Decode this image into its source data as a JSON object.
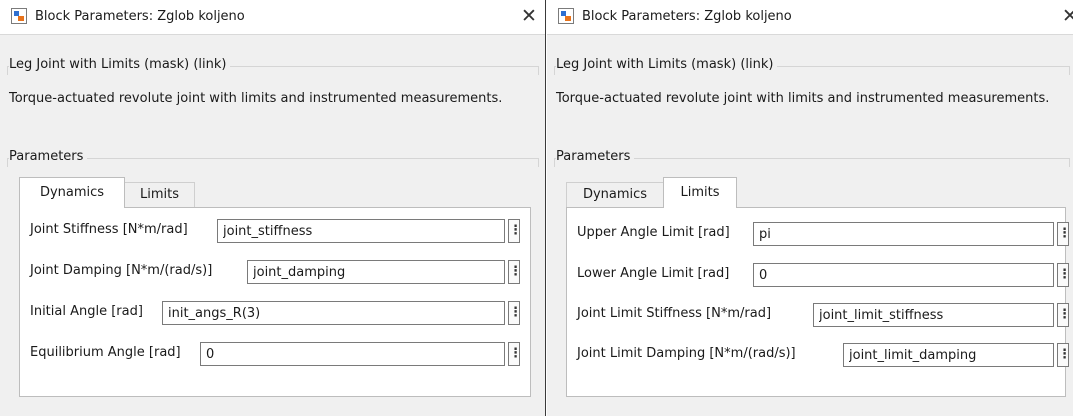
{
  "dialogs": [
    {
      "title": "Block Parameters: Zglob koljeno",
      "close_glyph": "✕",
      "group_title": "Leg Joint with Limits (mask) (link)",
      "description": "Torque-actuated revolute joint with limits and instrumented measurements.",
      "parameters_title": "Parameters",
      "tabs": [
        {
          "label": "Dynamics",
          "active": true
        },
        {
          "label": "Limits",
          "active": false
        }
      ],
      "params": [
        {
          "label": "Joint Stiffness [N*m/rad]",
          "value": "joint_stiffness",
          "menu": "⋮"
        },
        {
          "label": "Joint Damping [N*m/(rad/s)]",
          "value": "joint_damping",
          "menu": "⋮"
        },
        {
          "label": "Initial Angle [rad]",
          "value": "init_angs_R(3)",
          "menu": "⋮"
        },
        {
          "label": "Equilibrium Angle [rad]",
          "value": "0",
          "menu": "⋮"
        }
      ]
    },
    {
      "title": "Block Parameters: Zglob koljeno",
      "close_glyph": "✕",
      "group_title": "Leg Joint with Limits (mask) (link)",
      "description": "Torque-actuated revolute joint with limits and instrumented measurements.",
      "parameters_title": "Parameters",
      "tabs": [
        {
          "label": "Dynamics",
          "active": false
        },
        {
          "label": "Limits",
          "active": true
        }
      ],
      "params": [
        {
          "label": "Upper Angle Limit [rad]",
          "value": "pi",
          "menu": "⋮"
        },
        {
          "label": "Lower Angle Limit [rad]",
          "value": "0",
          "menu": "⋮"
        },
        {
          "label": "Joint Limit Stiffness [N*m/rad]",
          "value": "joint_limit_stiffness",
          "menu": "⋮"
        },
        {
          "label": "Joint Limit Damping [N*m/(rad/s)]",
          "value": "joint_limit_damping",
          "menu": "⋮"
        }
      ]
    }
  ],
  "colors": {
    "dialog_bg": "#f0f0f0",
    "titlebar_bg": "#ffffff",
    "panel_bg": "#ffffff",
    "icon_orange": "#e8731c",
    "icon_blue": "#2e6fd0"
  },
  "icons": {
    "app": "simulink-block-icon",
    "close": "close-icon",
    "menu": "kebab-menu-icon"
  }
}
